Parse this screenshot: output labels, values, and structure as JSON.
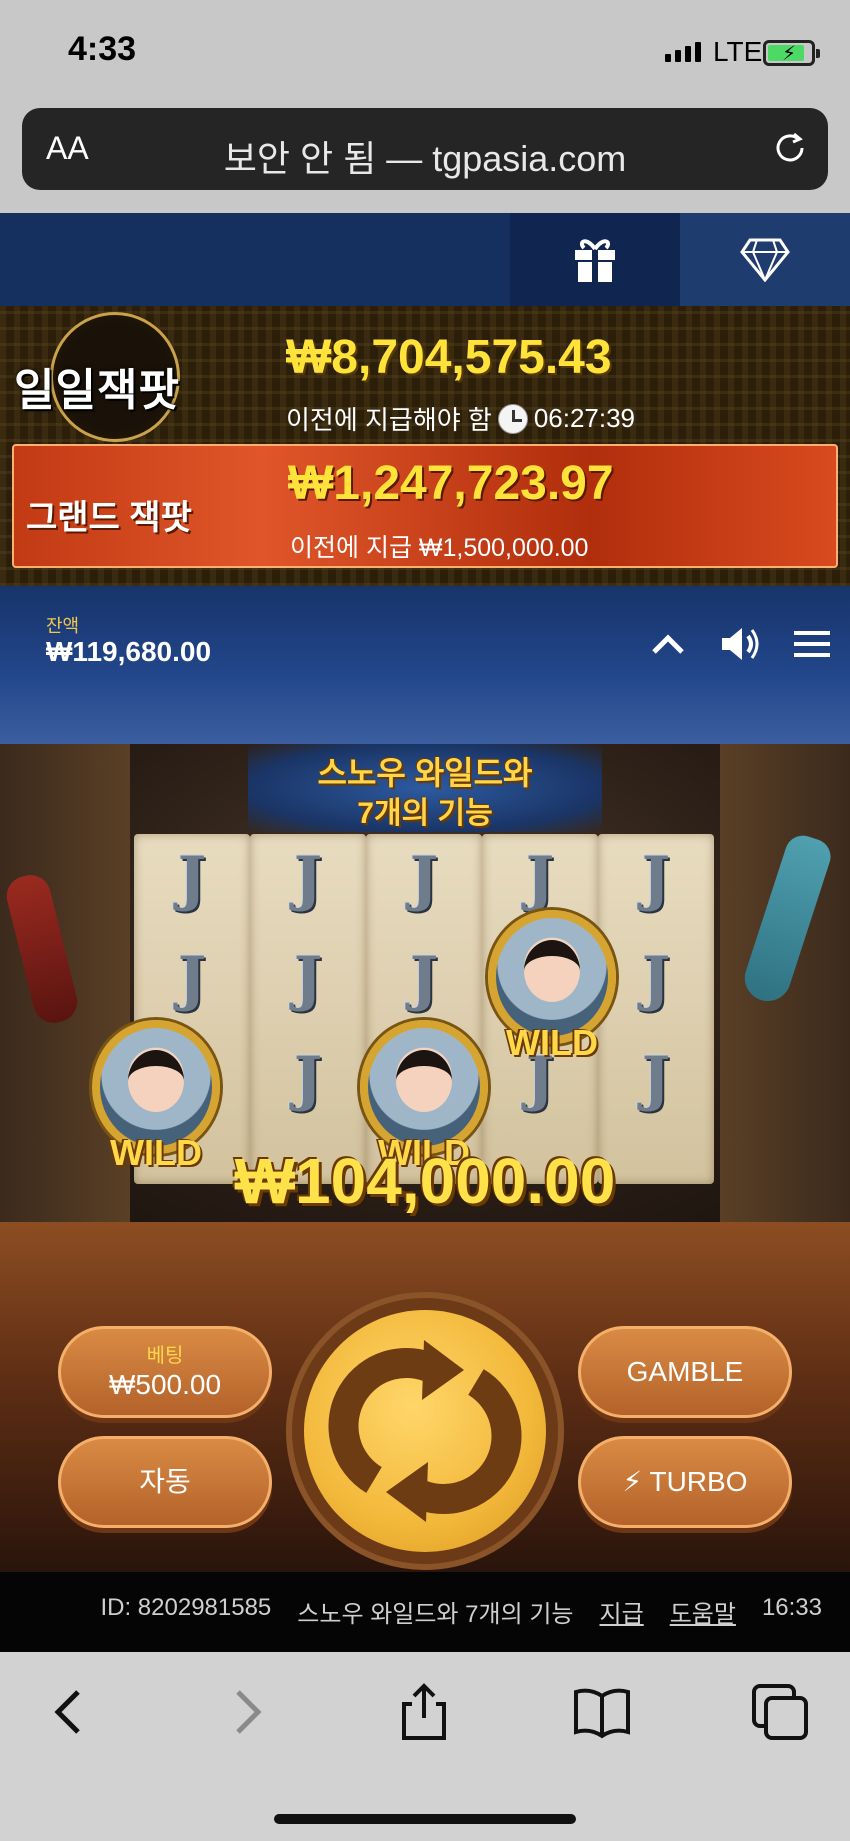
{
  "status": {
    "time": "4:33",
    "network": "LTE"
  },
  "browser": {
    "text_size_label": "AA",
    "url": "보안 안 됨 — tgpasia.com"
  },
  "jackpot": {
    "daily_label": "일일잭팟",
    "daily_amount": "₩8,704,575.43",
    "daily_note_prefix": "이전에 지급해야 함",
    "daily_countdown": "06:27:39",
    "grand_label": "그랜드 잭팟",
    "grand_amount": "₩1,247,723.97",
    "grand_note": "이전에 지급 ₩1,500,000.00"
  },
  "balance": {
    "label": "잔액",
    "value": "₩119,680.00"
  },
  "game": {
    "title_line1": "스노우 와일드와",
    "title_line2": "7개의 기능",
    "reel_symbol": "J",
    "wild_label": "WILD",
    "win_amount": "₩104,000.00"
  },
  "controls": {
    "bet_label": "베팅",
    "bet_value": "₩500.00",
    "auto_label": "자동",
    "gamble_label": "GAMBLE",
    "turbo_label": "TURBO"
  },
  "footer": {
    "id": "ID: 8202981585",
    "game_name": "스노우 와일드와 7개의 기능",
    "paytable_link": "지급",
    "help_link": "도움말",
    "clock": "16:33"
  },
  "icons": [
    "gift-icon",
    "diamond-icon",
    "chevron-up-icon",
    "volume-icon",
    "menu-icon",
    "spin-icon",
    "reload-icon",
    "back-icon",
    "forward-icon",
    "share-icon",
    "bookmarks-icon",
    "tabs-icon"
  ],
  "colors": {
    "jackpot_gold": "#ffe23a",
    "grand_red": "#c23a14",
    "game_blue": "#15305e",
    "spin_gold": "#f2b83a"
  }
}
